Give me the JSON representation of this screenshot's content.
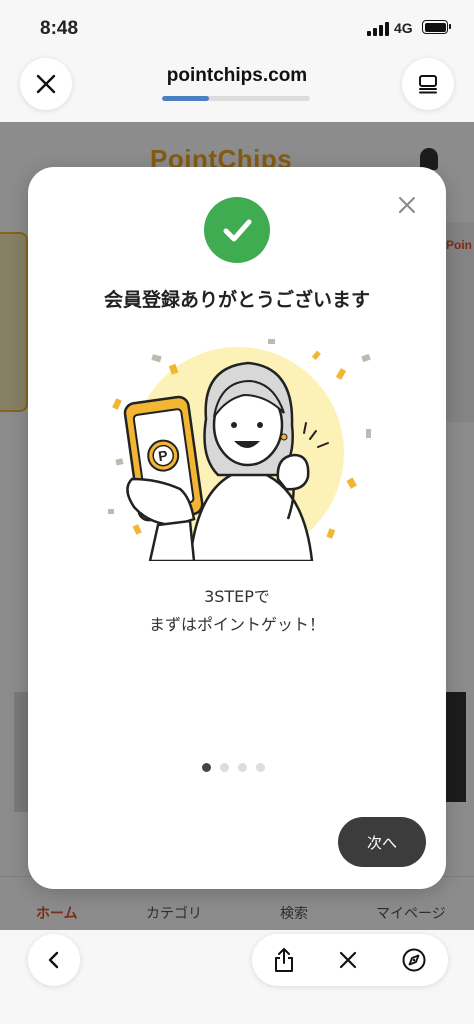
{
  "status_bar": {
    "time": "8:48",
    "network": "4G"
  },
  "browser": {
    "url": "pointchips.com",
    "load_progress": 0.32,
    "close_icon": "close-icon",
    "tabs_icon": "tabs-icon"
  },
  "page": {
    "logo_part1": "Point",
    "logo_part2": "Chips",
    "right_banner_text": "Poin",
    "tabs": [
      {
        "label": "ホーム",
        "active": true
      },
      {
        "label": "カテゴリ",
        "active": false
      },
      {
        "label": "検索",
        "active": false
      },
      {
        "label": "マイページ",
        "active": false
      }
    ]
  },
  "modal": {
    "title": "会員登録ありがとうございます",
    "subtitle_line1": "3STEPで",
    "subtitle_line2": "まずはポイントゲット！",
    "next_label": "次へ",
    "steps_total": 4,
    "step_current": 1
  },
  "bottom_bar": {
    "icons": [
      "back-icon",
      "share-icon",
      "close-icon",
      "compass-icon"
    ]
  },
  "colors": {
    "check_green": "#3fac52",
    "accent_yellow": "#f2b632",
    "illustration_bg": "#fcf2b8",
    "progress_blue": "#4a7fc1",
    "brand_orange": "#e0532c"
  }
}
